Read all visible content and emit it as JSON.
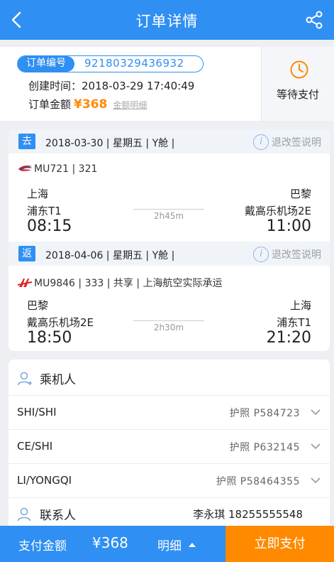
{
  "header": {
    "title": "订单详情"
  },
  "order": {
    "no_label": "订单编号",
    "no_value": "92180329436932",
    "created_label": "创建时间：",
    "created_value": "2018-03-29 17:40:49",
    "amount_label": "订单金额",
    "amount_value": "¥368",
    "amount_detail": "金额明细",
    "status": "等待支付"
  },
  "segments": [
    {
      "badge": "去",
      "date_line": "2018-03-30 | 星期五 | Y舱 |",
      "info": "退改签说明",
      "flight": "MU721 | 321",
      "dep_city": "上海",
      "arr_city": "巴黎",
      "dep_terminal": "浦东T1",
      "arr_terminal": "戴高乐机场2E",
      "dep_time": "08:15",
      "arr_time": "11:00",
      "duration": "2h45m"
    },
    {
      "badge": "返",
      "date_line": "2018-04-06 | 星期五 | Y舱 |",
      "info": "退改签说明",
      "flight": "MU9846 | 333 | 共享 | 上海航空实际承运",
      "dep_city": "巴黎",
      "arr_city": "上海",
      "dep_terminal": "戴高乐机场2E",
      "arr_terminal": "浦东T1",
      "dep_time": "18:50",
      "arr_time": "21:20",
      "duration": "2h30m"
    }
  ],
  "passengers": {
    "title": "乘机人",
    "list": [
      {
        "name": "SHI/SHI",
        "doc": "护照  P584723"
      },
      {
        "name": "CE/SHI",
        "doc": "护照  P632145"
      },
      {
        "name": "LI/YONGQI",
        "doc": "护照  P58464355"
      }
    ]
  },
  "contact": {
    "title": "联系人",
    "value": "李永琪  18255555548"
  },
  "bottom": {
    "pay_label": "支付金额",
    "pay_amount": "¥368",
    "detail_label": "明细",
    "pay_now": "立即支付"
  },
  "colors": {
    "primary": "#2f8ff2",
    "accent": "#ff8a00"
  }
}
